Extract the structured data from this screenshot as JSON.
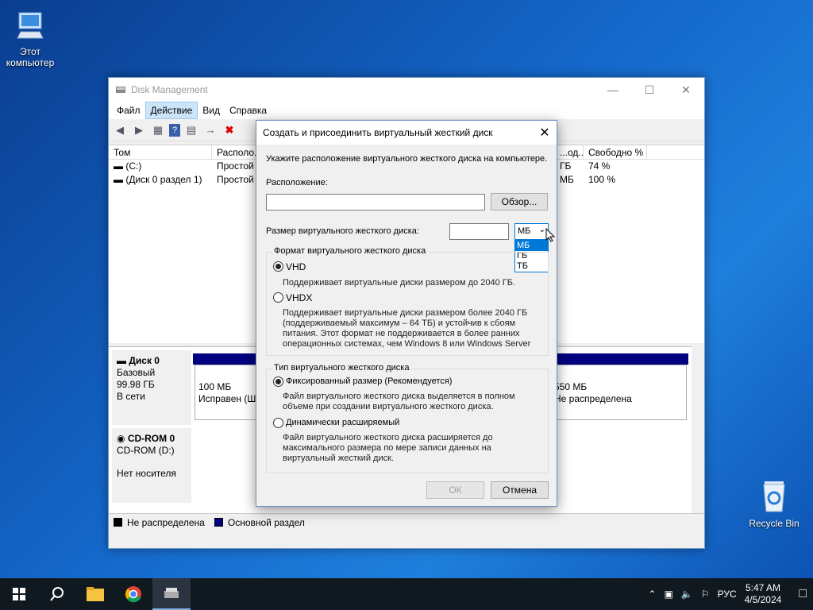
{
  "desktop": {
    "this_pc_label": "Этот компьютер",
    "recycle_bin_label": "Recycle Bin"
  },
  "window": {
    "title": "Disk Management",
    "menu": [
      "Файл",
      "Действие",
      "Вид",
      "Справка"
    ],
    "volume_columns": [
      "Том",
      "Располо...",
      "",
      "",
      "",
      "",
      "...од...",
      "Свободно %"
    ],
    "volumes": [
      {
        "name": "(C:)",
        "layout": "Простой",
        "free_tail": "ГБ",
        "free_pct": "74 %"
      },
      {
        "name": "(Диск 0 раздел 1)",
        "layout": "Простой",
        "free_tail": "МБ",
        "free_pct": "100 %"
      }
    ],
    "disk0": {
      "name": "Диск 0",
      "type": "Базовый",
      "size": "99.98 ГБ",
      "status": "В сети",
      "part1_size": "100 МБ",
      "part1_status": "Исправен (Ш",
      "part3_size": "550 МБ",
      "part3_status": "Не распределена"
    },
    "cdrom": {
      "name": "CD-ROM 0",
      "drive": "CD-ROM (D:)",
      "status": "Нет носителя"
    },
    "legend": {
      "unallocated": "Не распределена",
      "primary": "Основной раздел"
    }
  },
  "dialog": {
    "title": "Создать и присоединить виртуальный жесткий диск",
    "intro": "Укажите расположение виртуального жесткого диска на компьютере.",
    "location_label": "Расположение:",
    "location_value": "",
    "browse_button": "Обзор...",
    "size_label": "Размер виртуального жесткого диска:",
    "size_value": "",
    "unit_selected": "МБ",
    "unit_options": [
      "МБ",
      "ГБ",
      "ТБ"
    ],
    "format_group": "Формат виртуального жесткого диска",
    "vhd_label": "VHD",
    "vhd_desc": "Поддерживает виртуальные диски размером до 2040 ГБ.",
    "vhdx_label": "VHDX",
    "vhdx_desc": [
      "Поддерживает виртуальные диски размером более 2040 ГБ",
      "(поддерживаемый максимум – 64 ТБ) и устойчив к сбоям",
      "питания. Этот формат не поддерживается в более ранних",
      "операционных системах, чем Windows 8 или Windows Server"
    ],
    "type_group": "Тип виртуального жесткого диска",
    "fixed_label": "Фиксированный размер (Рекомендуется)",
    "fixed_desc": [
      "Файл виртуального жесткого диска выделяется в полном",
      "объеме при создании виртуального жесткого диска."
    ],
    "dynamic_label": "Динамически расширяемый",
    "dynamic_desc": [
      "Файл виртуального жесткого диска расширяется до",
      "максимального размера по мере записи данных на",
      "виртуальный жесткий диск."
    ],
    "ok_button": "ОК",
    "cancel_button": "Отмена"
  },
  "taskbar": {
    "language": "РУС",
    "time": "5:47 AM",
    "date": "4/5/2024"
  }
}
